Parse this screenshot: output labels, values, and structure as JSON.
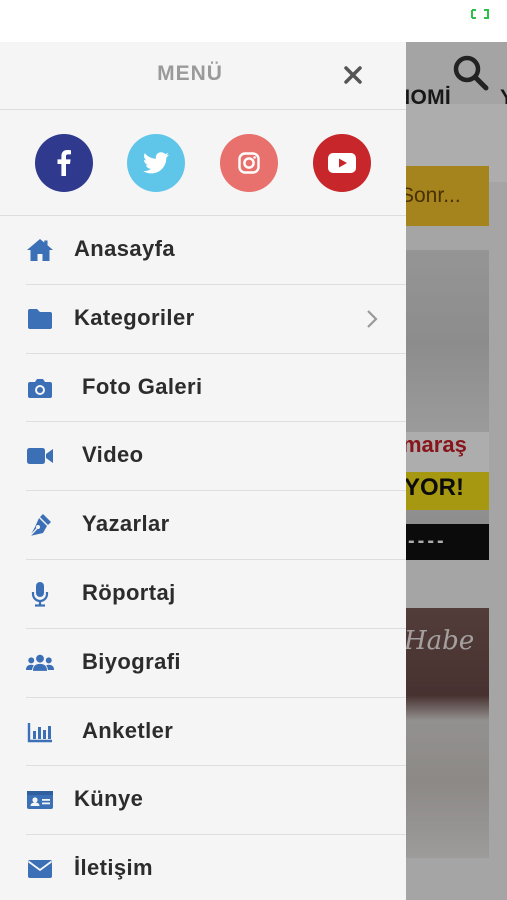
{
  "background": {
    "nav_text": "NOMİ",
    "nav_next": "Y",
    "banner_text": "Sonr...",
    "image1_red_text": "maraş",
    "image1_yellow_text": "YOR!",
    "image1_dash_text": "----",
    "image2_script": "Habe"
  },
  "drawer": {
    "title": "MENÜ",
    "social": [
      "facebook",
      "twitter",
      "instagram",
      "youtube"
    ],
    "items": [
      {
        "label": "Anasayfa",
        "icon": "home-icon"
      },
      {
        "label": "Kategoriler",
        "icon": "folder-icon",
        "has_submenu": true
      },
      {
        "label": "Foto Galeri",
        "icon": "camera-icon"
      },
      {
        "label": "Video",
        "icon": "video-camera-icon"
      },
      {
        "label": "Yazarlar",
        "icon": "pen-nib-icon"
      },
      {
        "label": "Röportaj",
        "icon": "microphone-icon"
      },
      {
        "label": "Biyografi",
        "icon": "users-icon"
      },
      {
        "label": "Anketler",
        "icon": "bar-chart-icon"
      },
      {
        "label": "Künye",
        "icon": "id-card-icon"
      },
      {
        "label": "İletişim",
        "icon": "envelope-icon"
      }
    ]
  },
  "colors": {
    "accent": "#3b6fb6",
    "facebook": "#2f3a8f",
    "twitter": "#5fc6ea",
    "instagram": "#e8716d",
    "youtube": "#c7272b"
  }
}
